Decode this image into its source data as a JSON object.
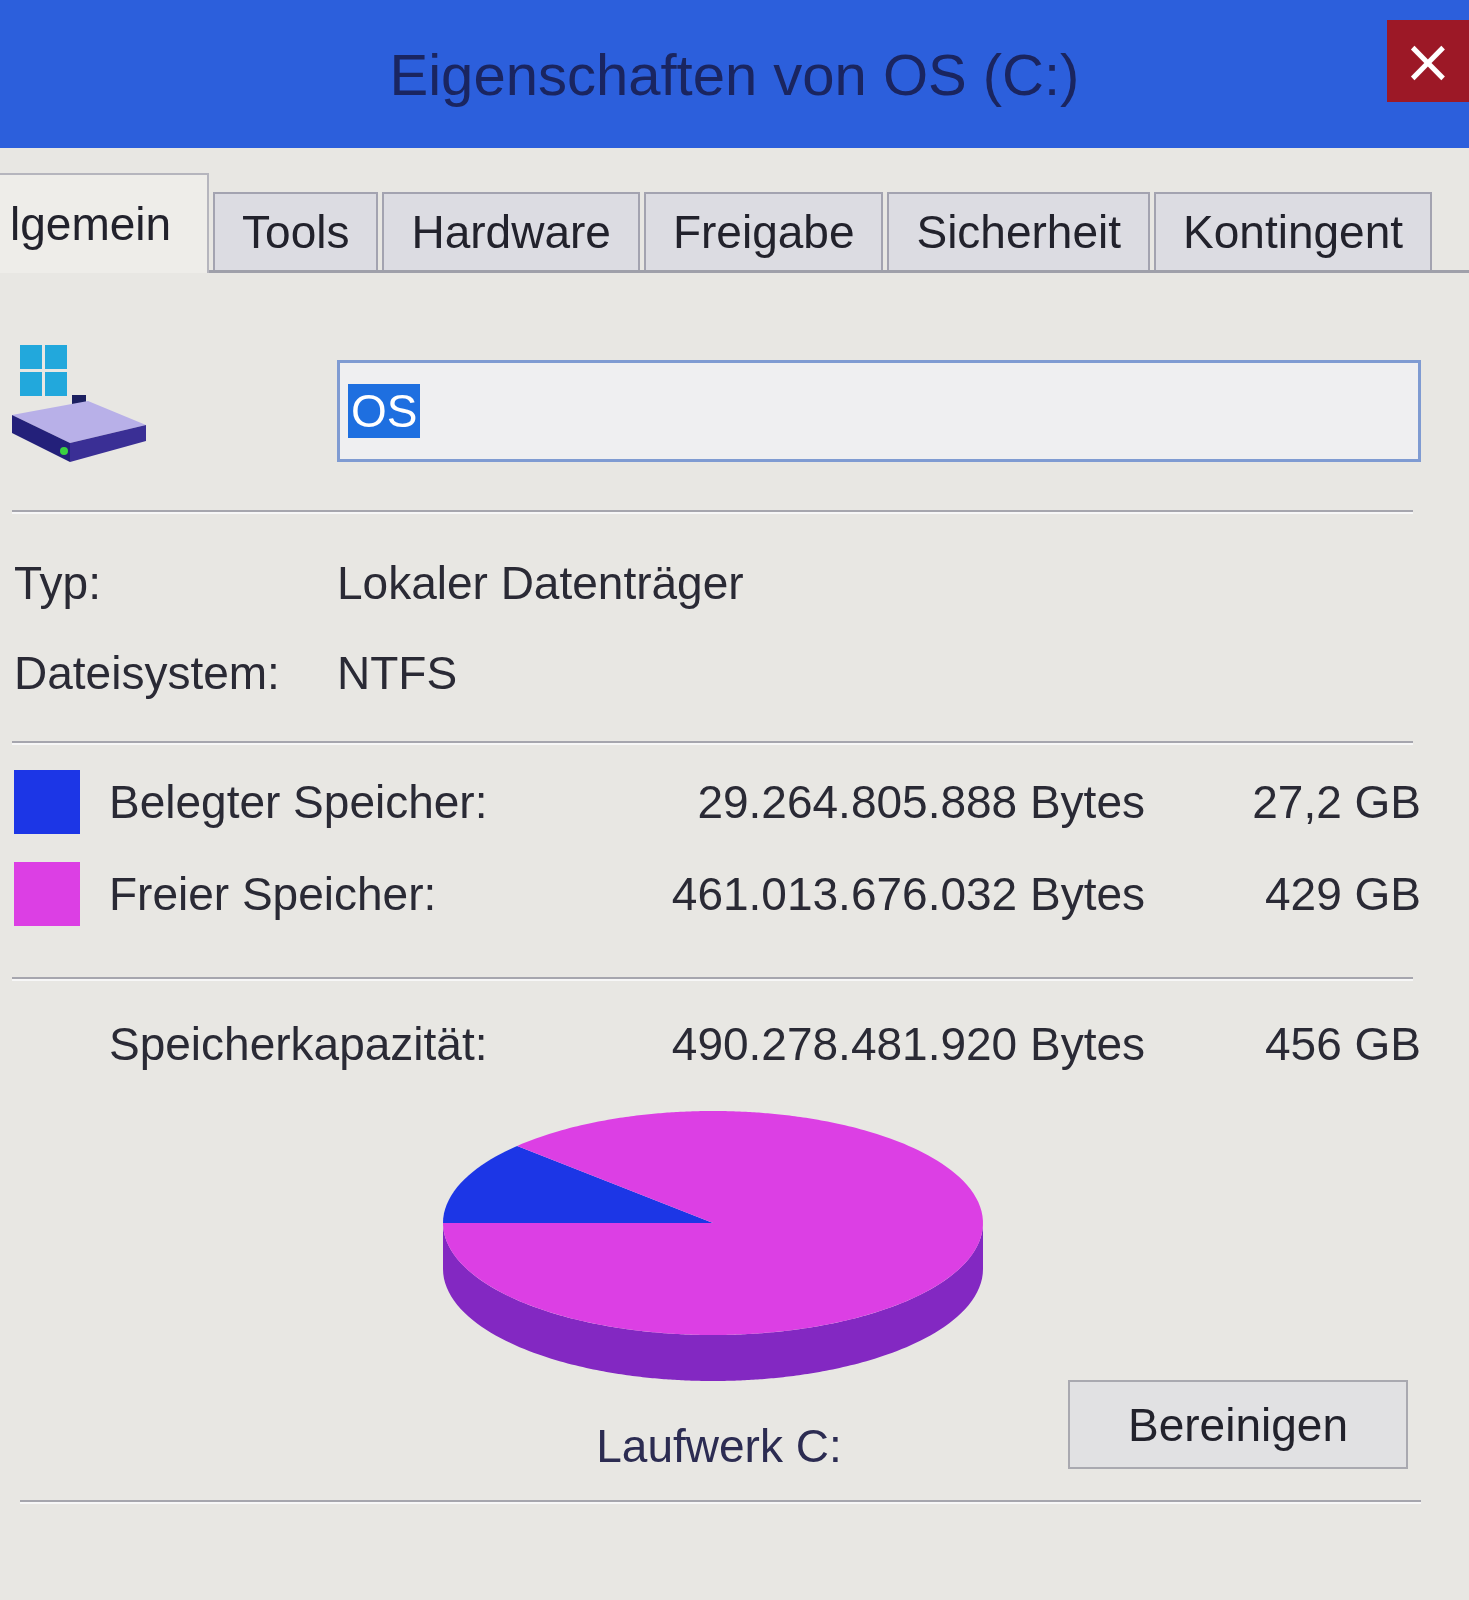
{
  "window": {
    "title": "Eigenschaften von OS (C:)",
    "close_label": "×"
  },
  "tabs": [
    {
      "label": "lgemein",
      "selected": true
    },
    {
      "label": "Tools",
      "selected": false
    },
    {
      "label": "Hardware",
      "selected": false
    },
    {
      "label": "Freigabe",
      "selected": false
    },
    {
      "label": "Sicherheit",
      "selected": false
    },
    {
      "label": "Kontingent",
      "selected": false
    }
  ],
  "general": {
    "name_field": {
      "value": "OS",
      "text_selected": true
    },
    "properties": [
      {
        "label": "Typ:",
        "value": "Lokaler Datenträger"
      },
      {
        "label": "Dateisystem:",
        "value": "NTFS"
      }
    ],
    "space": [
      {
        "label": "Belegter Speicher:",
        "bytes": "29.264.805.888 Bytes",
        "size": "27,2 GB",
        "color": "#1c36e6"
      },
      {
        "label": "Freier Speicher:",
        "bytes": "461.013.676.032 Bytes",
        "size": "429 GB",
        "color": "#dc3fe4"
      }
    ],
    "capacity": {
      "label": "Speicherkapazität:",
      "bytes": "490.278.481.920 Bytes",
      "size": "456 GB"
    },
    "drive_label": "Laufwerk C:",
    "cleanup_button": "Bereinigen"
  }
}
